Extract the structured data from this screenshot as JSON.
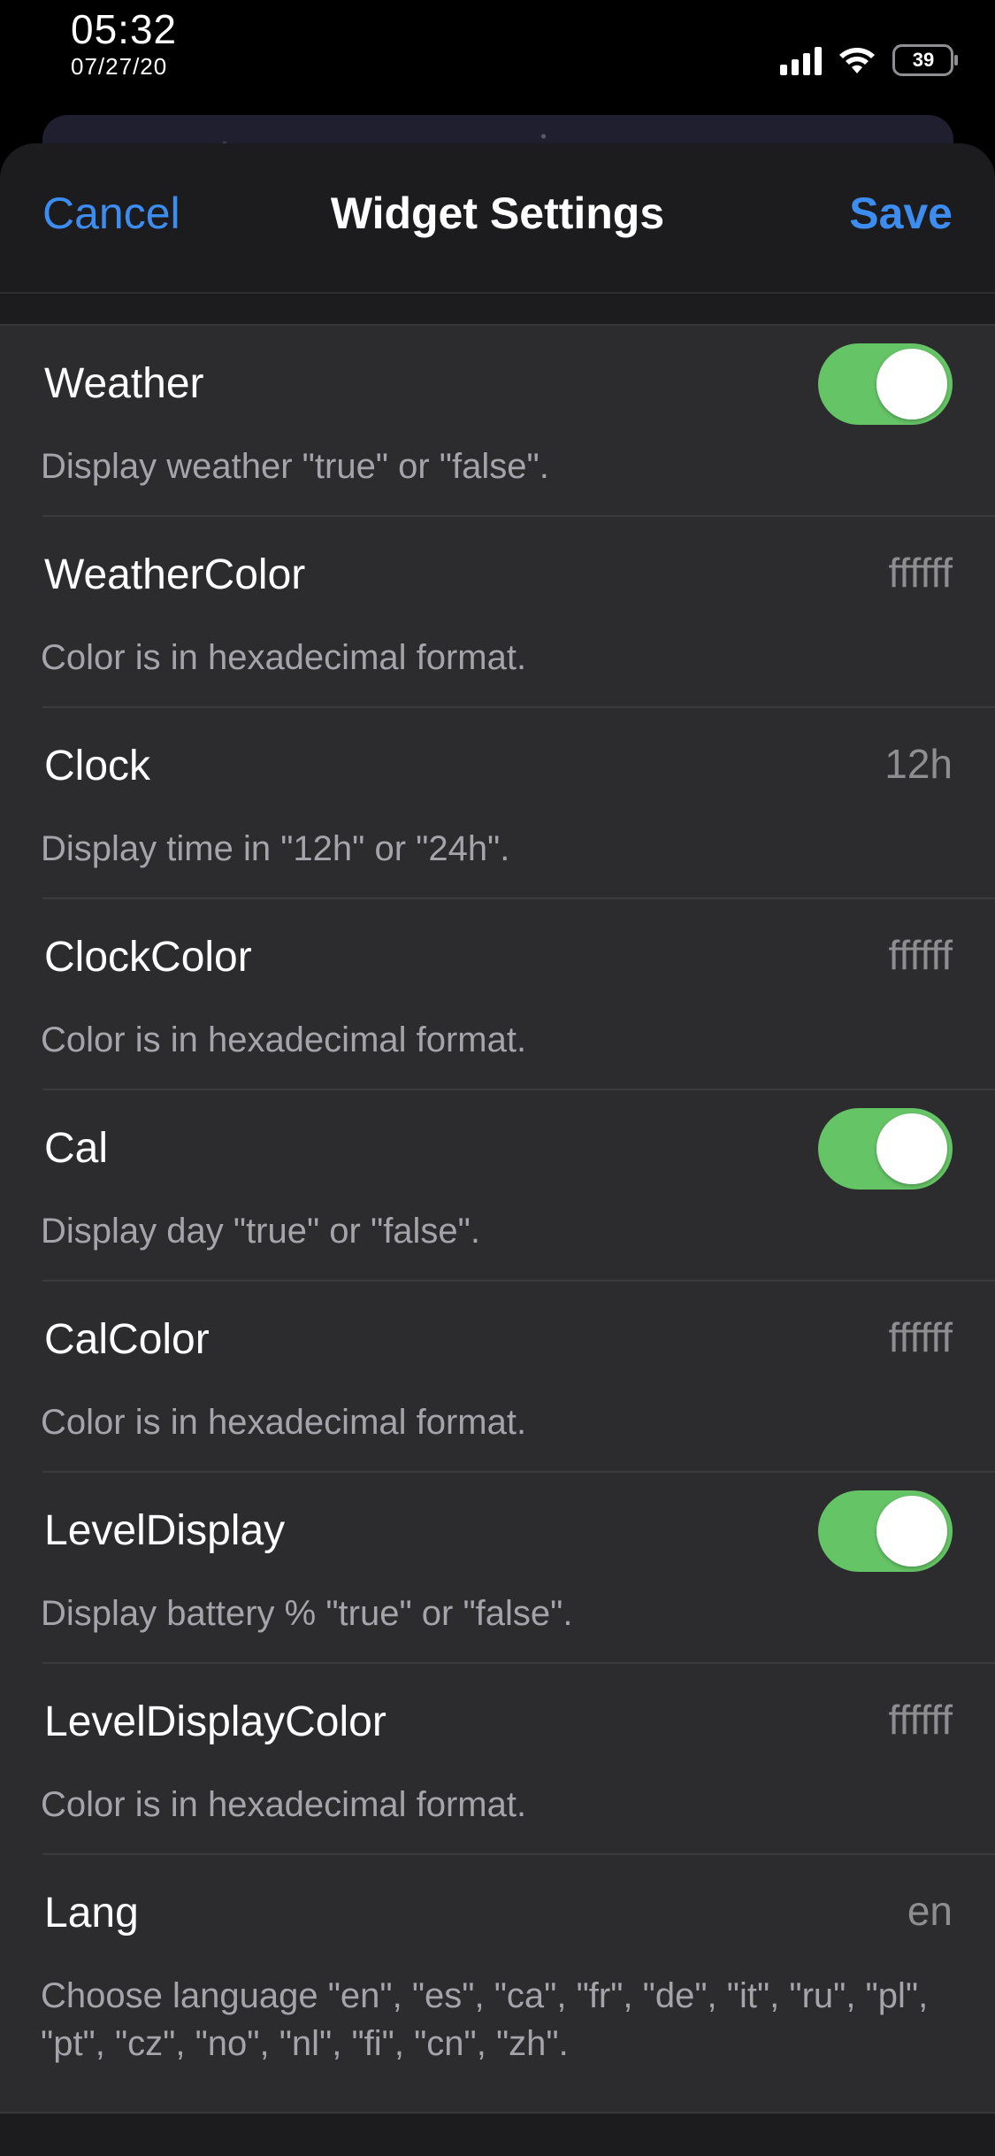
{
  "status_bar": {
    "time": "05:32",
    "date": "07/27/20",
    "battery": "39"
  },
  "nav": {
    "cancel_label": "Cancel",
    "title": "Widget Settings",
    "save_label": "Save"
  },
  "colors": {
    "accent": "#3d8cf0",
    "toggle_on": "#65c466"
  },
  "settings": [
    {
      "label": "Weather",
      "type": "toggle",
      "on": true,
      "description": "Display weather \"true\" or \"false\"."
    },
    {
      "label": "WeatherColor",
      "type": "text",
      "value": "ffffff",
      "description": "Color is in hexadecimal format."
    },
    {
      "label": "Clock",
      "type": "text",
      "value": "12h",
      "description": "Display time in \"12h\" or \"24h\"."
    },
    {
      "label": "ClockColor",
      "type": "text",
      "value": "ffffff",
      "description": "Color is in hexadecimal format."
    },
    {
      "label": "Cal",
      "type": "toggle",
      "on": true,
      "description": "Display day \"true\" or \"false\"."
    },
    {
      "label": "CalColor",
      "type": "text",
      "value": "ffffff",
      "description": "Color is in hexadecimal format."
    },
    {
      "label": "LevelDisplay",
      "type": "toggle",
      "on": true,
      "description": "Display battery % \"true\" or \"false\"."
    },
    {
      "label": "LevelDisplayColor",
      "type": "text",
      "value": "ffffff",
      "description": "Color is in hexadecimal format."
    },
    {
      "label": "Lang",
      "type": "text",
      "value": "en",
      "description": "Choose language \"en\", \"es\", \"ca\", \"fr\", \"de\", \"it\", \"ru\", \"pl\", \"pt\", \"cz\", \"no\", \"nl\", \"fi\", \"cn\", \"zh\"."
    }
  ]
}
